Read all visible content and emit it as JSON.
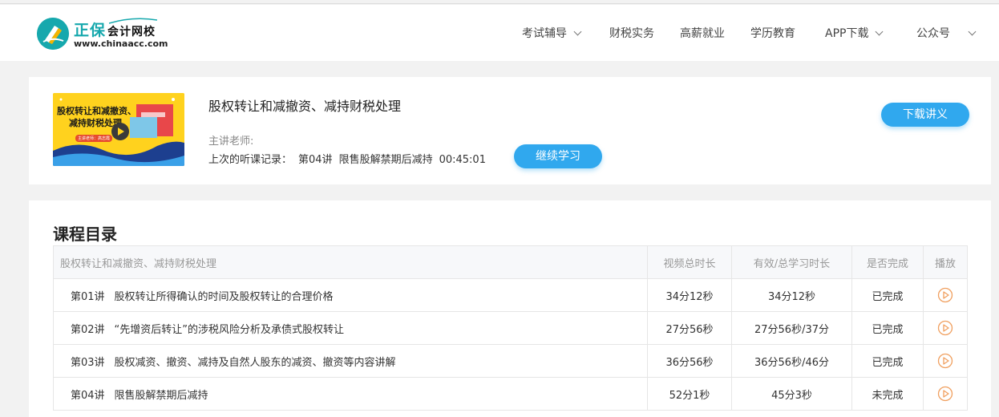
{
  "logo": {
    "brand": "正保",
    "brand_sub": "会计网校",
    "url": "www.chinaacc.com"
  },
  "nav": {
    "items": [
      {
        "label": "考试辅导",
        "dropdown": true
      },
      {
        "label": "财税实务",
        "dropdown": false
      },
      {
        "label": "高薪就业",
        "dropdown": false
      },
      {
        "label": "学历教育",
        "dropdown": false
      },
      {
        "label": "APP下载",
        "dropdown": true
      },
      {
        "label": "公众号",
        "dropdown": true
      }
    ]
  },
  "course": {
    "thumbnail_title_line1": "股权转让和减撤资、",
    "thumbnail_title_line2": "减持财税处理",
    "thumbnail_tag": "主讲老师：高志霞",
    "title": "股权转让和减撤资、减持财税处理",
    "teacher_label": "主讲老师:",
    "last_record_label": "上次的听课记录：",
    "last_record_lecture": "第04讲",
    "last_record_title": "限售股解禁期后减持",
    "last_record_time": "00:45:01",
    "continue_button": "继续学习",
    "download_button": "下载讲义"
  },
  "catalog": {
    "section_title": "课程目录",
    "headers": [
      "股权转让和减撤资、减持财税处理",
      "视频总时长",
      "有效/总学习时长",
      "是否完成",
      "播放"
    ],
    "rows": [
      {
        "lecture": "第01讲",
        "title": "股权转让所得确认的时间及股权转让的合理价格",
        "duration": "34分12秒",
        "study": "34分12秒",
        "status": "已完成",
        "done": true
      },
      {
        "lecture": "第02讲",
        "title": "“先增资后转让”的涉税风险分析及承债式股权转让",
        "duration": "27分56秒",
        "study": "27分56秒/37分",
        "status": "已完成",
        "done": true
      },
      {
        "lecture": "第03讲",
        "title": "股权减资、撤资、减持及自然人股东的减资、撤资等内容讲解",
        "duration": "36分56秒",
        "study": "36分56秒/46分",
        "status": "已完成",
        "done": true
      },
      {
        "lecture": "第04讲",
        "title": "限售股解禁期后减持",
        "duration": "52分1秒",
        "study": "45分3秒",
        "status": "未完成",
        "done": false
      }
    ]
  },
  "colors": {
    "accent_blue": "#30a8ee",
    "brand_teal": "#16a8ad",
    "done_green": "#2e8b2e",
    "undone_red": "#e02020",
    "play_orange": "#f0a060"
  }
}
